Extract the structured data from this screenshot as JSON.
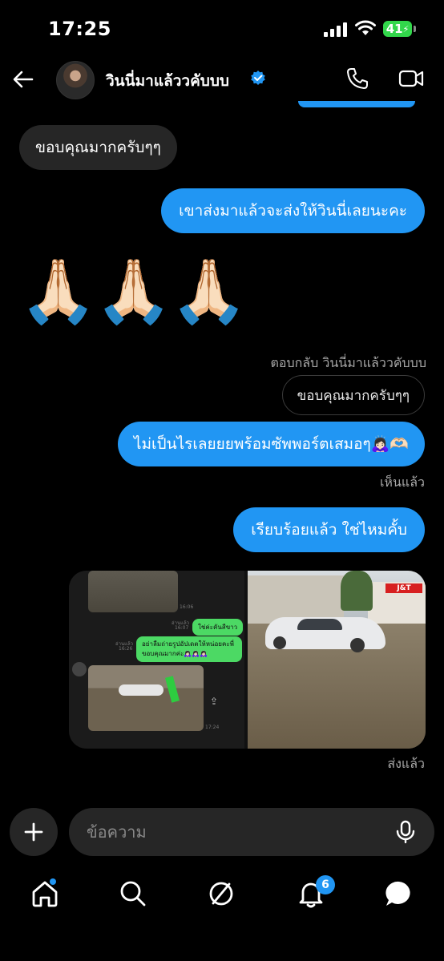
{
  "status_bar": {
    "time": "17:25",
    "battery": "41"
  },
  "header": {
    "contact_name": "วินนี่มาแล้ววคับบบ",
    "icons": [
      "back-arrow-icon",
      "verified-badge-icon",
      "phone-icon",
      "video-camera-icon"
    ]
  },
  "messages": {
    "m1_text": "ขอบคุณมากครับๆๆ",
    "m2_text": "เขาส่งมาแล้วจะส่งให้วินนี่เลยนะคะ",
    "m3_emoji": [
      "🙏🏻",
      "🙏🏻",
      "🙏🏻"
    ],
    "reply_meta": "ตอบกลับ วินนี่มาแล้ววคับบบ",
    "reply_quote": "ขอบคุณมากครับๆๆ",
    "m4_text": "ไม่เป็นไรเลยยยพร้อมซัพพอร์ตเสมอๆ🙇🏻‍♀️🫶🏻",
    "m4_status": "เห็นแล้ว",
    "m5_text": "เรียบร้อยแล้ว ใช่ไหมคั้บ",
    "media_status": "ส่งแล้ว"
  },
  "media": {
    "left_chat": {
      "time_1": "16:06",
      "read_1": "อ่านแล้ว",
      "time_2": "16:07",
      "bubble_1": "ใช่ค่ะคันสีขาว",
      "read_2": "อ่านแล้ว",
      "time_3": "16:26",
      "bubble_2": "อย่าลืมถ่ายรูปอัปเดตให้หน่อยคะพี่",
      "bubble_3": "ขอบคุณมากค่ะ🙇🏻‍♀️🙇🏻‍♀️🙇🏻‍♀️",
      "time_4": "17:24"
    },
    "right_photo": {
      "shop_sign": "J&T"
    }
  },
  "composer": {
    "placeholder": "ข้อความ"
  },
  "tabbar": {
    "icons": [
      "home-icon",
      "search-icon",
      "explore-icon",
      "notifications-icon",
      "messages-icon"
    ],
    "notification_count": "6"
  },
  "colors": {
    "accent": "#2196f3",
    "incoming_bubble": "#262626",
    "background": "#000000",
    "battery": "#32d74b"
  }
}
